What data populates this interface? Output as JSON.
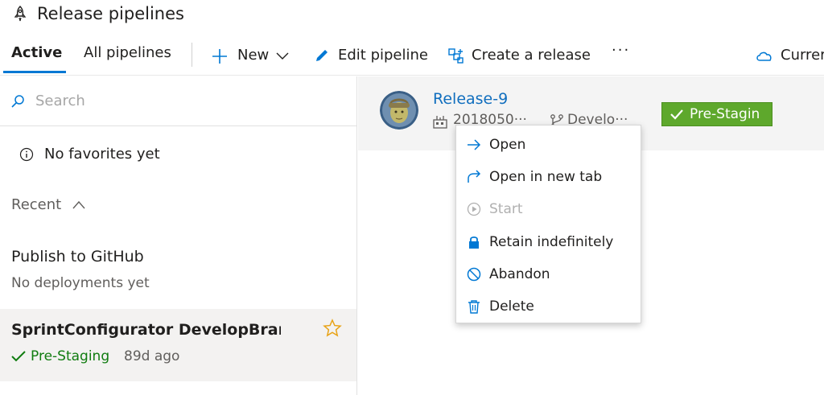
{
  "header": {
    "title": "Release pipelines",
    "icon": "rocket-icon"
  },
  "tabs": [
    {
      "label": "Active",
      "active": true
    },
    {
      "label": "All pipelines",
      "active": false
    }
  ],
  "toolbar": {
    "new_label": "New",
    "edit_label": "Edit pipeline",
    "create_label": "Create a release",
    "more_label": "···",
    "current_label": "Currer"
  },
  "search": {
    "placeholder": "Search",
    "value": ""
  },
  "favorites": {
    "empty_label": "No favorites yet"
  },
  "recent": {
    "label": "Recent"
  },
  "pipelines": [
    {
      "name": "Publish to GitHub",
      "sub": "No deployments yet"
    },
    {
      "name": "SprintConfigurator DevelopBran···",
      "status": "Pre-Staging",
      "ago": "89d ago",
      "favorite": false
    }
  ],
  "release": {
    "name": "Release-9",
    "build": "2018050···",
    "branch": "Develo···",
    "stage": "Pre-Stagin"
  },
  "context_menu": {
    "items": [
      {
        "label": "Open",
        "icon": "arrow-right-icon",
        "enabled": true
      },
      {
        "label": "Open in new tab",
        "icon": "redo-arrow-icon",
        "enabled": true
      },
      {
        "label": "Start",
        "icon": "play-circle-icon",
        "enabled": false
      },
      {
        "label": "Retain indefinitely",
        "icon": "lock-icon",
        "enabled": true
      },
      {
        "label": "Abandon",
        "icon": "block-icon",
        "enabled": true
      },
      {
        "label": "Delete",
        "icon": "trash-icon",
        "enabled": true
      }
    ]
  },
  "colors": {
    "accent": "#0078d4",
    "link": "#106ebe",
    "success": "#107c10",
    "stage_badge": "#5ea82c",
    "star": "#e8a317"
  }
}
